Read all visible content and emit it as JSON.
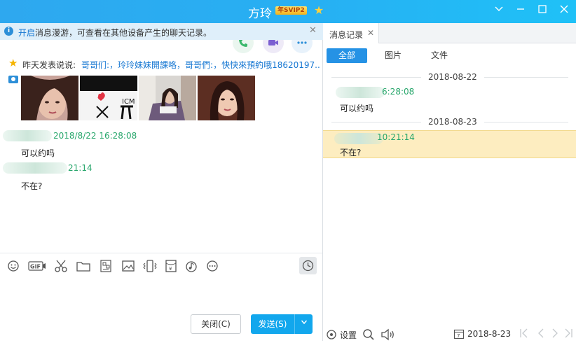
{
  "window": {
    "title": "方玲",
    "vip_badge": "年SVIP2",
    "buttons": [
      "chevron-down",
      "minimize",
      "maximize",
      "close"
    ]
  },
  "notice": {
    "link": "开启",
    "text": "消息漫游，可查看在其他设备产生的聊天记录。"
  },
  "mood": {
    "label": "昨天发表说说:",
    "content": "哥哥们:，玲玲妹妹開課咯，哥哥們:，快快來預約哦18620197..."
  },
  "chat": {
    "messages": [
      {
        "time": "2018/8/22 16:28:08",
        "text": "可以约吗"
      },
      {
        "time": "21:14",
        "text": "不在?"
      }
    ]
  },
  "compose": {
    "close_label": "关闭(C)",
    "send_label": "发送(S)"
  },
  "history": {
    "tab_label": "消息记录",
    "filters": [
      "全部",
      "图片",
      "文件"
    ],
    "groups": [
      {
        "date": "2018-08-22",
        "time": "6:28:08",
        "text": "可以约吗"
      },
      {
        "date": "2018-08-23",
        "time": "10:21:14",
        "text": "不在?"
      }
    ],
    "settings_label": "设置",
    "current_date": "2018-8-23"
  },
  "colors": {
    "title_bar": "#27b0f3",
    "send_button": "#12a7ed",
    "timestamp_green": "#27a66b",
    "highlight_row": "#fdedc0"
  }
}
